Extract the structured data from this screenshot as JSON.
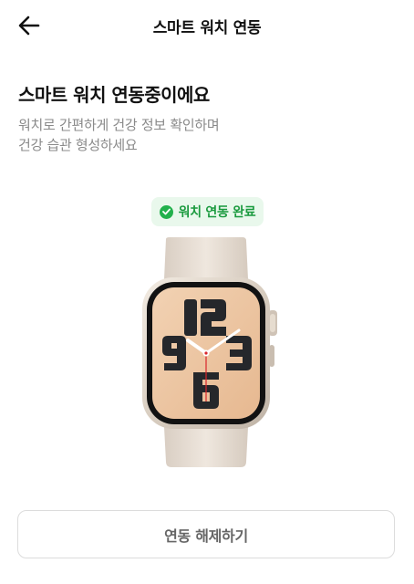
{
  "header": {
    "title": "스마트 워치 연동",
    "back_icon": "arrow-left-icon"
  },
  "main": {
    "headline": "스마트 워치 연동중이에요",
    "description_lines": [
      "워치로 간편하게 건강 정보 확인하며",
      "건강 습관 형성하세요"
    ],
    "status_badge": {
      "label": "워치 연동 완료",
      "icon": "check-circle-icon",
      "color": "#22b14c",
      "background": "#e9f8ec"
    },
    "watch_image": {
      "icon": "smartwatch-illustration",
      "face_numerals": [
        "12",
        "9",
        "3",
        "6"
      ]
    }
  },
  "footer": {
    "unlink_button_label": "연동 해제하기"
  }
}
